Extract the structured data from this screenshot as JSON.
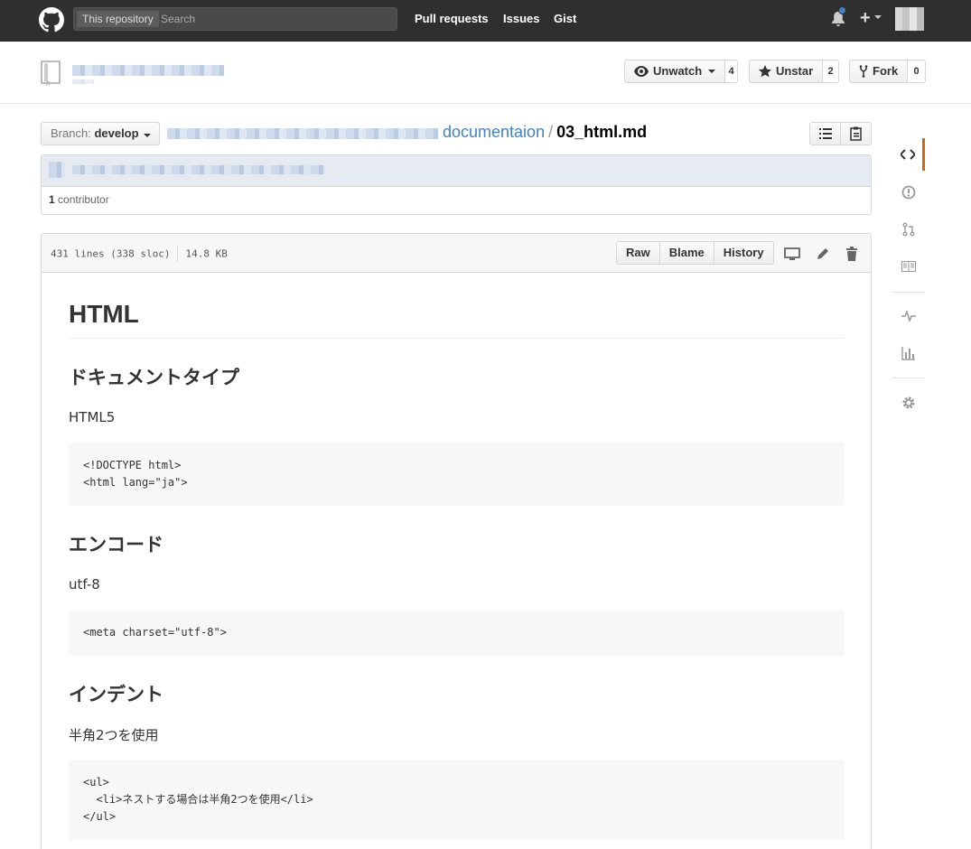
{
  "header": {
    "search_scope": "This repository",
    "search_placeholder": "Search",
    "nav": [
      "Pull requests",
      "Issues",
      "Gist"
    ],
    "plus": "+"
  },
  "repo": {
    "watch_label": "Unwatch",
    "watch_count": "4",
    "star_label": "Unstar",
    "star_count": "2",
    "fork_label": "Fork",
    "fork_count": "0"
  },
  "breadcrumb": {
    "branch_prefix": "Branch:",
    "branch_name": "develop",
    "folder": "documentaion",
    "separator": "/",
    "file": "03_html.md"
  },
  "commit": {
    "contributor_count": "1",
    "contributor_label": "contributor"
  },
  "file": {
    "lines": "431 lines (338 sloc)",
    "size": "14.8 KB",
    "actions": [
      "Raw",
      "Blame",
      "History"
    ]
  },
  "markdown": {
    "h1": "HTML",
    "s1_title": "ドキュメントタイプ",
    "s1_text": "HTML5",
    "s1_code": "<!DOCTYPE html>\n<html lang=\"ja\">",
    "s2_title": "エンコード",
    "s2_text": "utf-8",
    "s2_code": "<meta charset=\"utf-8\">",
    "s3_title": "インデント",
    "s3_text": "半角2つを使用",
    "s3_code": "<ul>\n  <li>ネストする場合は半角2つを使用</li>\n</ul>"
  },
  "colors": {
    "header_bg": "#2f2f2f",
    "link": "#4183c4",
    "active_tab": "#d26911"
  }
}
